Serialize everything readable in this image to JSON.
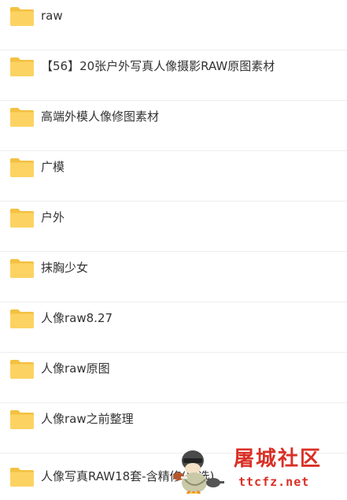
{
  "folders": [
    {
      "name": "raw"
    },
    {
      "name": "【56】20张户外写真人像摄影RAW原图素材"
    },
    {
      "name": "高端外模人像修图素材"
    },
    {
      "name": "广模"
    },
    {
      "name": "户外"
    },
    {
      "name": "抹胸少女"
    },
    {
      "name": "人像raw8.27"
    },
    {
      "name": "人像raw原图"
    },
    {
      "name": "人像raw之前整理"
    },
    {
      "name": "人像写真RAW18套-含精修(精选)"
    }
  ],
  "icons": {
    "folder": "folder-icon"
  },
  "colors": {
    "folder_back": "#F3C142",
    "folder_front": "#FCD362",
    "text": "#333333",
    "watermark": "#D93026"
  },
  "watermark": {
    "title": "屠城社区",
    "url": "ttcfz.net"
  }
}
